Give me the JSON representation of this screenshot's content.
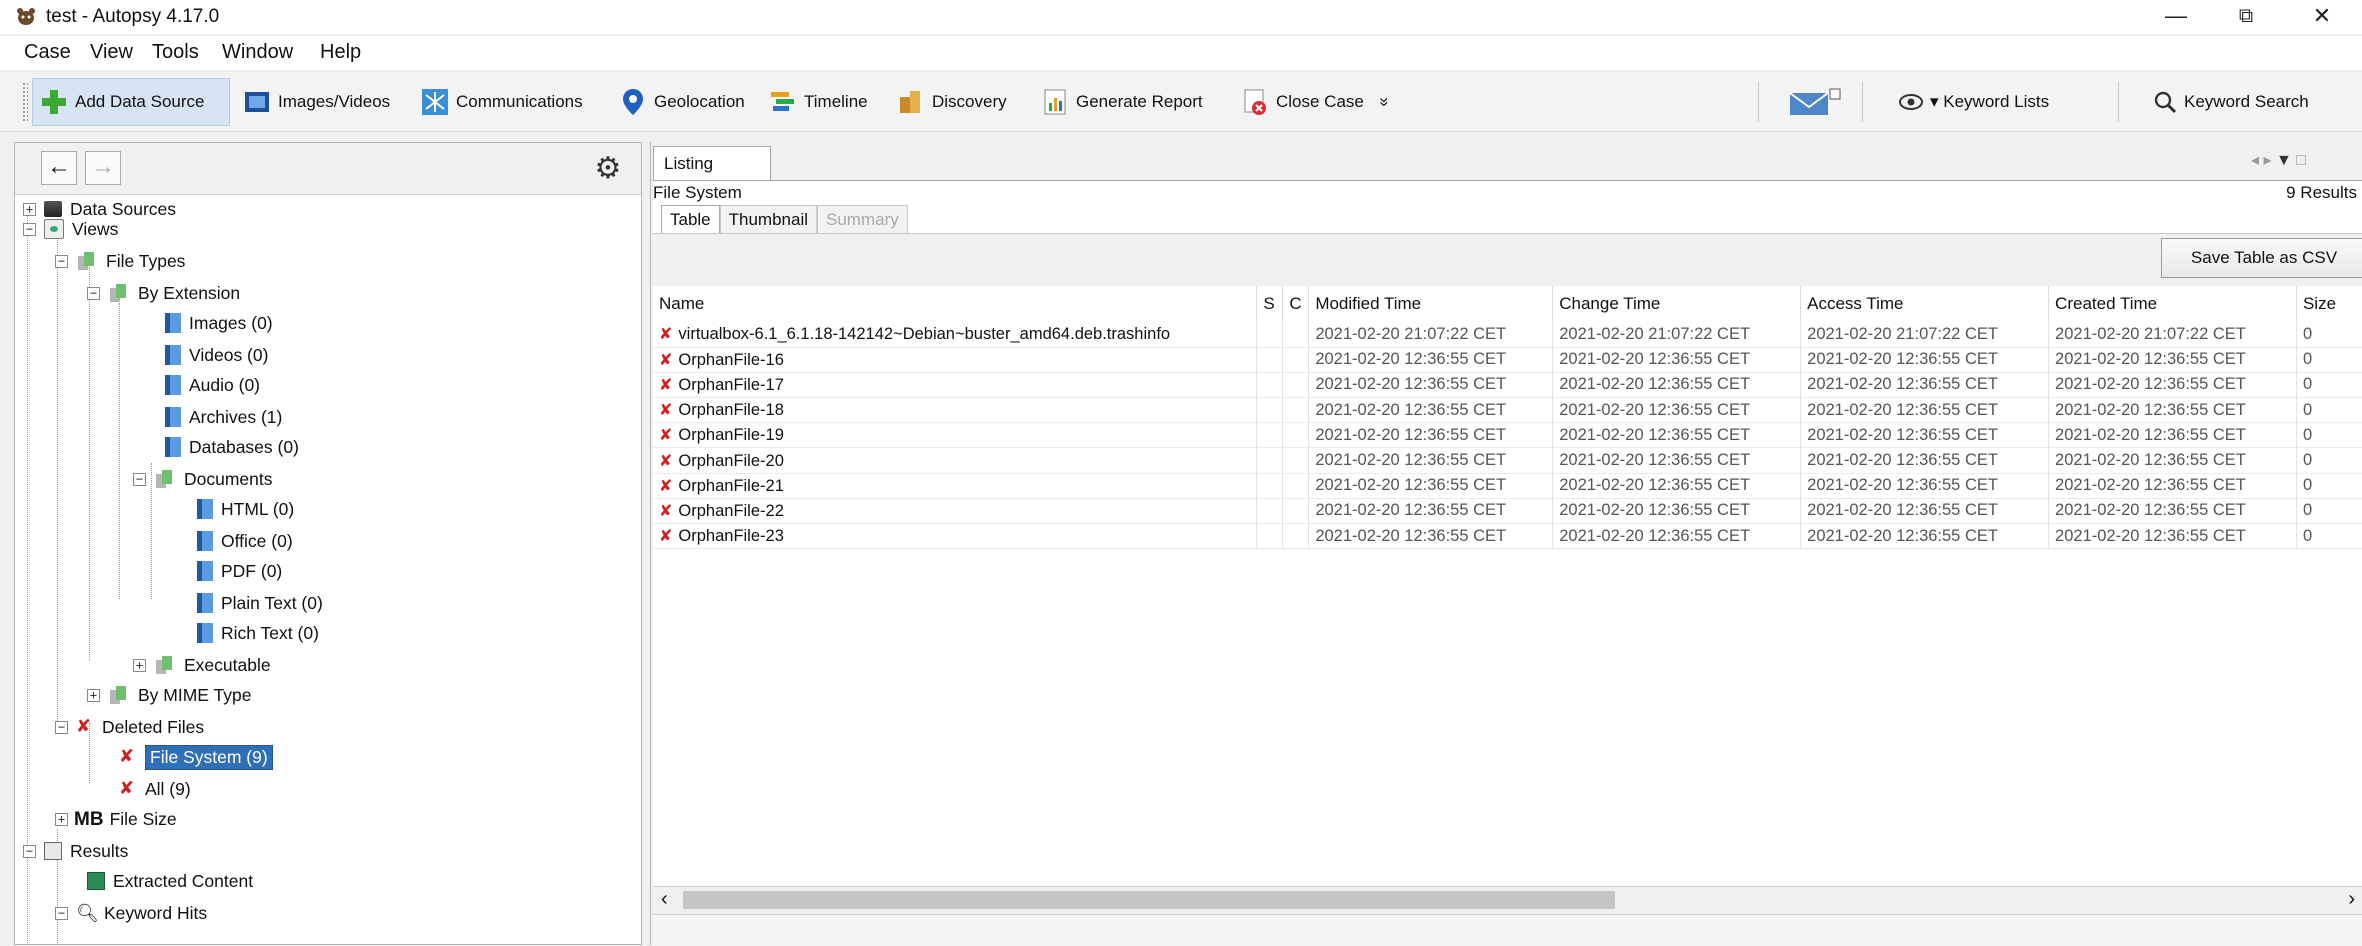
{
  "window": {
    "title": "test - Autopsy 4.17.0",
    "minimize": "—",
    "restore": "⧉",
    "close": "✕"
  },
  "menu": [
    "Case",
    "View",
    "Tools",
    "Window",
    "Help"
  ],
  "toolbar": {
    "add_data_source": "Add Data Source",
    "images_videos": "Images/Videos",
    "communications": "Communications",
    "geolocation": "Geolocation",
    "timeline": "Timeline",
    "discovery": "Discovery",
    "generate_report": "Generate Report",
    "close_case": "Close Case",
    "overflow": "»",
    "keyword_lists": "▾ Keyword Lists",
    "keyword_search": "Keyword Search"
  },
  "nav": {
    "back": "←",
    "forward": "→",
    "settings_icon": "gear-icon"
  },
  "tree": {
    "data_sources": "Data Sources",
    "views": "Views",
    "file_types": "File Types",
    "by_extension": "By Extension",
    "images": "Images (0)",
    "videos": "Videos (0)",
    "audio": "Audio (0)",
    "archives": "Archives (1)",
    "databases": "Databases (0)",
    "documents": "Documents",
    "html": "HTML (0)",
    "office": "Office (0)",
    "pdf": "PDF (0)",
    "plain_text": "Plain Text (0)",
    "rich_text": "Rich Text (0)",
    "executable": "Executable",
    "by_mime": "By MIME Type",
    "deleted_files": "Deleted Files",
    "file_system": "File System (9)",
    "all": "All (9)",
    "mb_prefix": "MB",
    "file_size": "File Size",
    "results": "Results",
    "extracted_content": "Extracted Content",
    "keyword_hits": "Keyword Hits"
  },
  "listing": {
    "tab": "Listing",
    "breadcrumb": "File System",
    "results_count": "9 Results",
    "subtabs": {
      "table": "Table",
      "thumbnail": "Thumbnail",
      "summary": "Summary"
    },
    "save_csv": "Save Table as CSV",
    "columns": [
      "Name",
      "S",
      "C",
      "Modified Time",
      "Change Time",
      "Access Time",
      "Created Time",
      "Size"
    ],
    "rows": [
      {
        "name": "virtualbox-6.1_6.1.18-142142~Debian~buster_amd64.deb.trashinfo",
        "mtime": "2021-02-20 21:07:22 CET",
        "ctime": "2021-02-20 21:07:22 CET",
        "atime": "2021-02-20 21:07:22 CET",
        "crtime": "2021-02-20 21:07:22 CET",
        "size": "0"
      },
      {
        "name": "OrphanFile-16",
        "mtime": "2021-02-20 12:36:55 CET",
        "ctime": "2021-02-20 12:36:55 CET",
        "atime": "2021-02-20 12:36:55 CET",
        "crtime": "2021-02-20 12:36:55 CET",
        "size": "0"
      },
      {
        "name": "OrphanFile-17",
        "mtime": "2021-02-20 12:36:55 CET",
        "ctime": "2021-02-20 12:36:55 CET",
        "atime": "2021-02-20 12:36:55 CET",
        "crtime": "2021-02-20 12:36:55 CET",
        "size": "0"
      },
      {
        "name": "OrphanFile-18",
        "mtime": "2021-02-20 12:36:55 CET",
        "ctime": "2021-02-20 12:36:55 CET",
        "atime": "2021-02-20 12:36:55 CET",
        "crtime": "2021-02-20 12:36:55 CET",
        "size": "0"
      },
      {
        "name": "OrphanFile-19",
        "mtime": "2021-02-20 12:36:55 CET",
        "ctime": "2021-02-20 12:36:55 CET",
        "atime": "2021-02-20 12:36:55 CET",
        "crtime": "2021-02-20 12:36:55 CET",
        "size": "0"
      },
      {
        "name": "OrphanFile-20",
        "mtime": "2021-02-20 12:36:55 CET",
        "ctime": "2021-02-20 12:36:55 CET",
        "atime": "2021-02-20 12:36:55 CET",
        "crtime": "2021-02-20 12:36:55 CET",
        "size": "0"
      },
      {
        "name": "OrphanFile-21",
        "mtime": "2021-02-20 12:36:55 CET",
        "ctime": "2021-02-20 12:36:55 CET",
        "atime": "2021-02-20 12:36:55 CET",
        "crtime": "2021-02-20 12:36:55 CET",
        "size": "0"
      },
      {
        "name": "OrphanFile-22",
        "mtime": "2021-02-20 12:36:55 CET",
        "ctime": "2021-02-20 12:36:55 CET",
        "atime": "2021-02-20 12:36:55 CET",
        "crtime": "2021-02-20 12:36:55 CET",
        "size": "0"
      },
      {
        "name": "OrphanFile-23",
        "mtime": "2021-02-20 12:36:55 CET",
        "ctime": "2021-02-20 12:36:55 CET",
        "atime": "2021-02-20 12:36:55 CET",
        "crtime": "2021-02-20 12:36:55 CET",
        "size": "0"
      }
    ]
  },
  "colors": {
    "selection": "#2f6fb8",
    "deleted_mark": "#d21f1f",
    "active_toolbar": "#d6e4f4"
  }
}
